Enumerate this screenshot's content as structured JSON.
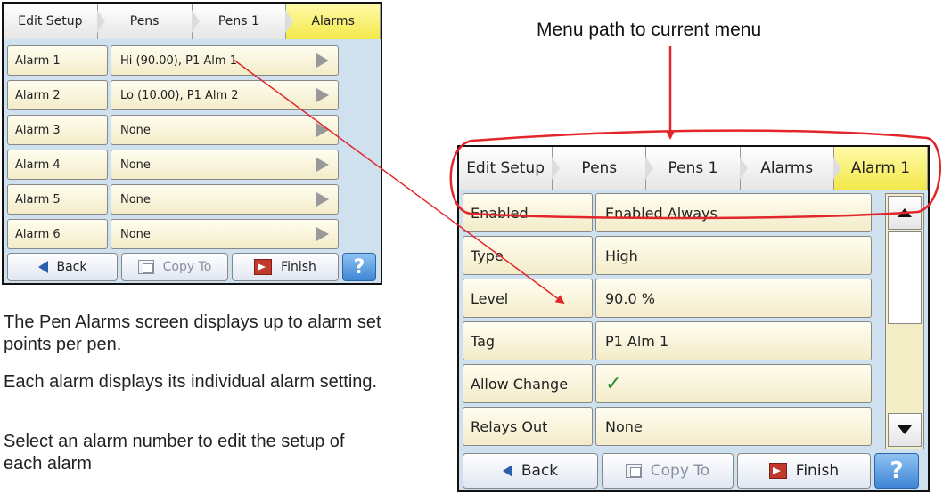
{
  "annotation": {
    "menu_path_label": "Menu path to current menu"
  },
  "screen1": {
    "breadcrumbs": [
      "Edit Setup",
      "Pens",
      "Pens 1",
      "Alarms"
    ],
    "rows": [
      {
        "label": "Alarm 1",
        "value": "Hi (90.00), P1 Alm 1"
      },
      {
        "label": "Alarm 2",
        "value": "Lo (10.00), P1 Alm 2"
      },
      {
        "label": "Alarm 3",
        "value": "None"
      },
      {
        "label": "Alarm 4",
        "value": "None"
      },
      {
        "label": "Alarm 5",
        "value": "None"
      },
      {
        "label": "Alarm 6",
        "value": "None"
      }
    ],
    "buttons": {
      "back": "Back",
      "copy": "Copy To",
      "finish": "Finish",
      "help": "?"
    }
  },
  "screen2": {
    "breadcrumbs": [
      "Edit Setup",
      "Pens",
      "Pens 1",
      "Alarms",
      "Alarm 1"
    ],
    "rows": [
      {
        "label": "Enabled",
        "value": "Enabled Always"
      },
      {
        "label": "Type",
        "value": "High"
      },
      {
        "label": "Level",
        "value": "90.0 %"
      },
      {
        "label": "Tag",
        "value": "P1 Alm 1"
      },
      {
        "label": "Allow Change",
        "value": "✓"
      },
      {
        "label": "Relays Out",
        "value": "None"
      }
    ],
    "buttons": {
      "back": "Back",
      "copy": "Copy To",
      "finish": "Finish",
      "help": "?"
    }
  },
  "description": {
    "p1": "The Pen Alarms screen displays up to alarm set points per pen.",
    "p2": "Each alarm displays its individual alarm setting.",
    "p3": "Select an alarm number to edit the setup of each alarm"
  },
  "colors": {
    "annotation_red": "#e3262b",
    "active_crumb": "#f3e84a",
    "screen_bg": "#cfe0ef"
  }
}
